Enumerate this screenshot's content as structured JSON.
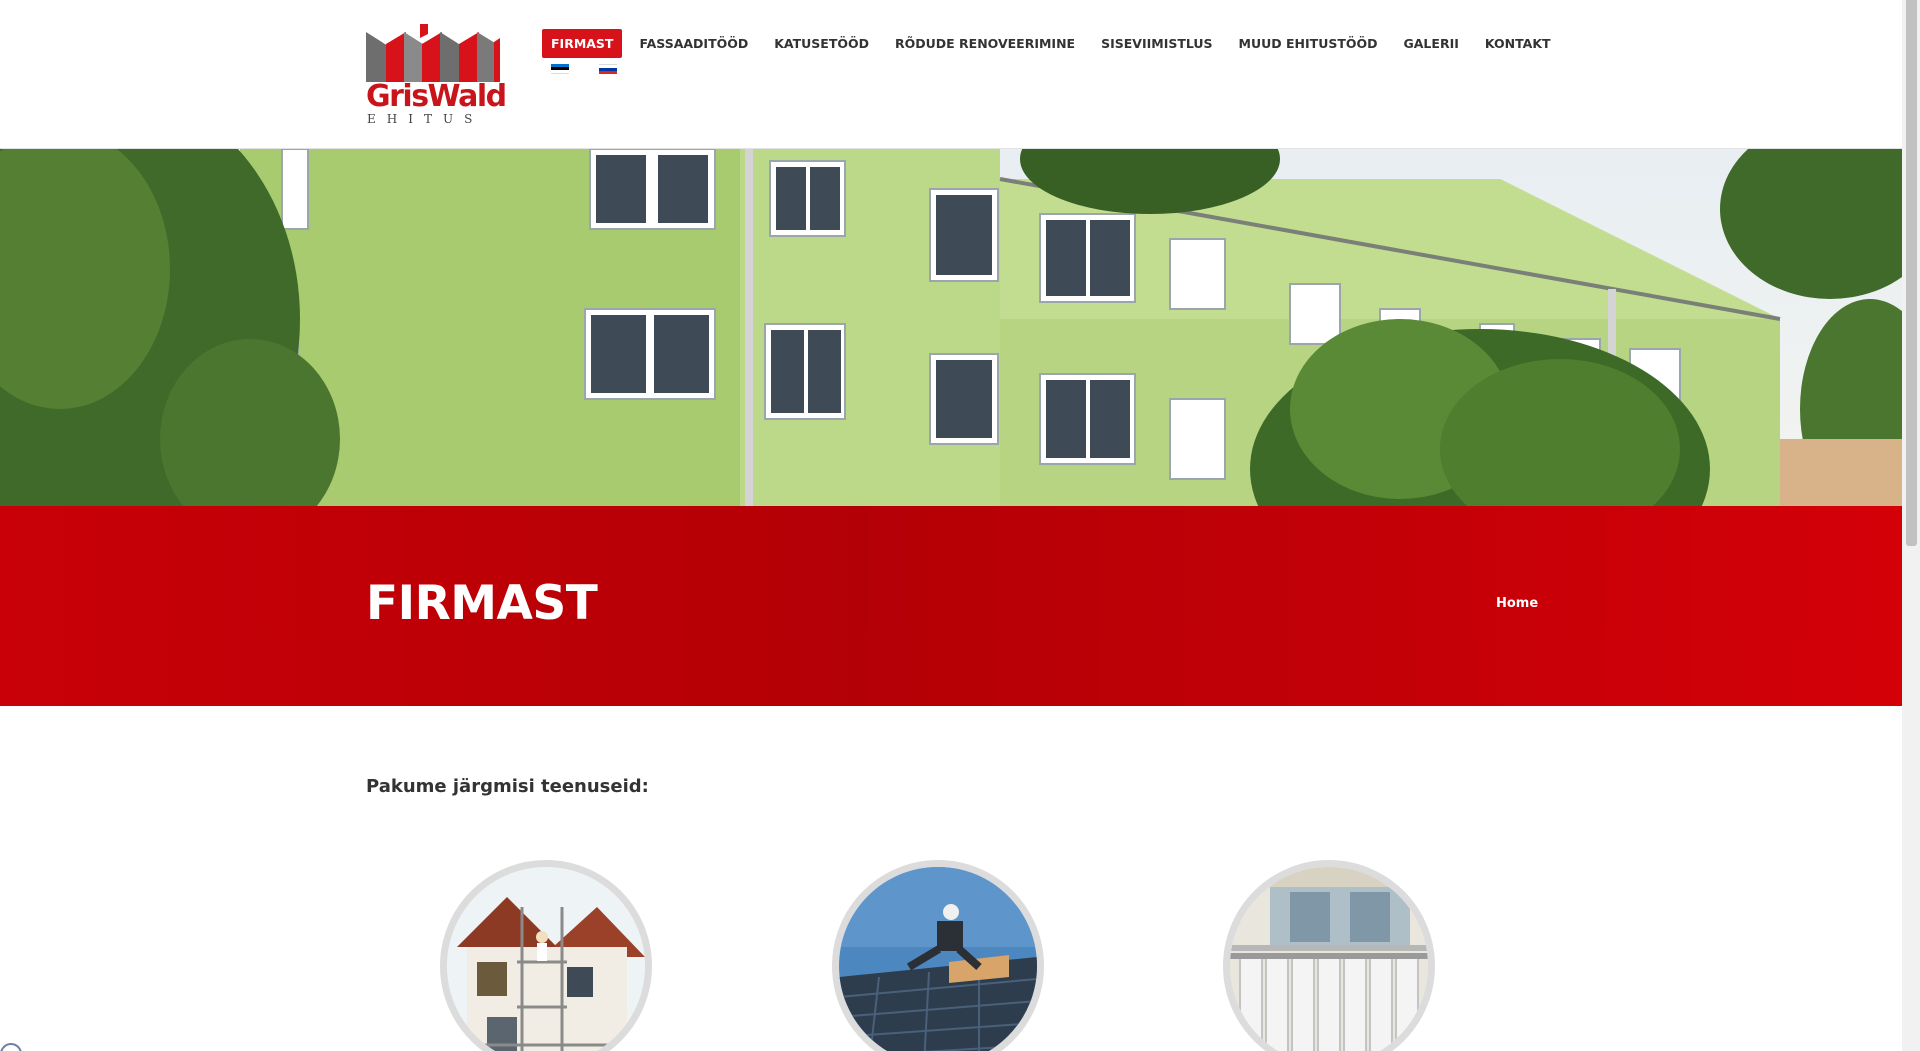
{
  "header": {
    "logo": {
      "name": "GrisWald",
      "subtitle": "EHITUS",
      "colors": {
        "primary": "#d7121a",
        "secondary": "#6e6e6e"
      }
    },
    "nav": {
      "items": [
        {
          "label": "FIRMAST",
          "active": true
        },
        {
          "label": "FASSAADITÖÖD",
          "active": false
        },
        {
          "label": "KATUSETÖÖD",
          "active": false
        },
        {
          "label": "RÕDUDE RENOVEERIMINE",
          "active": false
        },
        {
          "label": "SISEVIIMISTLUS",
          "active": false
        },
        {
          "label": "MUUD EHITUSTÖÖD",
          "active": false
        },
        {
          "label": "GALERII",
          "active": false
        },
        {
          "label": "KONTAKT",
          "active": false
        }
      ]
    },
    "languages": [
      {
        "icon": "estonian-flag-icon",
        "colors": [
          "#0072ce",
          "#000000",
          "#ffffff"
        ]
      },
      {
        "icon": "russian-flag-icon",
        "colors": [
          "#ffffff",
          "#0039a6",
          "#d52b1e"
        ]
      }
    ]
  },
  "hero": {
    "image": "green-apartment-building-photo"
  },
  "banner": {
    "title": "FIRMAST",
    "breadcrumb": "Home",
    "accent": "#c90007"
  },
  "content": {
    "heading": "Pakume järgmisi teenuseid:",
    "services": [
      {
        "image": "facade-scaffolding-photo"
      },
      {
        "image": "roofer-on-roof-photo"
      },
      {
        "image": "balcony-railing-photo"
      }
    ]
  }
}
